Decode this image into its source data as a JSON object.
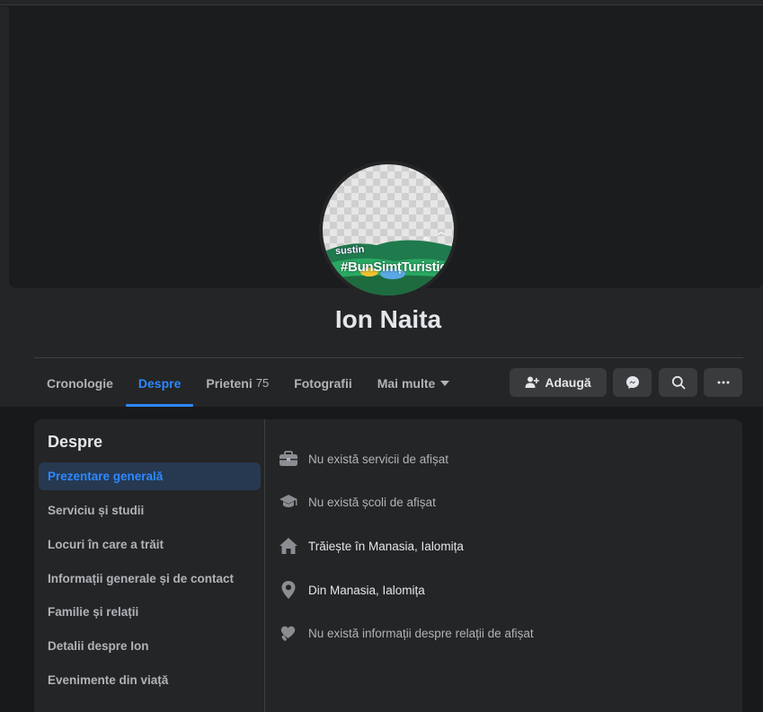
{
  "profile": {
    "name": "Ion Naita",
    "avatar_text_small": "sustin",
    "avatar_text_large": "#BunSimțTuristic"
  },
  "tabs": [
    {
      "label": "Cronologie"
    },
    {
      "label": "Despre"
    },
    {
      "label": "Prieteni",
      "count": "75"
    },
    {
      "label": "Fotografii"
    },
    {
      "label": "Mai multe"
    }
  ],
  "actions": {
    "add_friend_label": "Adaugă"
  },
  "about": {
    "title": "Despre",
    "menu": [
      "Prezentare generală",
      "Serviciu și studii",
      "Locuri în care a trăit",
      "Informații generale și de contact",
      "Familie și relații",
      "Detalii despre Ion",
      "Evenimente din viață"
    ],
    "overview": [
      {
        "icon": "briefcase-icon",
        "text": "Nu există servicii de afișat"
      },
      {
        "icon": "graduation-cap-icon",
        "text": "Nu există școli de afișat"
      },
      {
        "icon": "home-icon",
        "text": "Trăiește în Manasia, Ialomița"
      },
      {
        "icon": "location-pin-icon",
        "text": "Din Manasia, Ialomița"
      },
      {
        "icon": "heart-icon",
        "text": "Nu există informații despre relații de afișat"
      }
    ]
  },
  "colors": {
    "accent": "#2d88ff",
    "background": "#18191a",
    "surface": "#242526",
    "button": "#3a3b3c"
  }
}
